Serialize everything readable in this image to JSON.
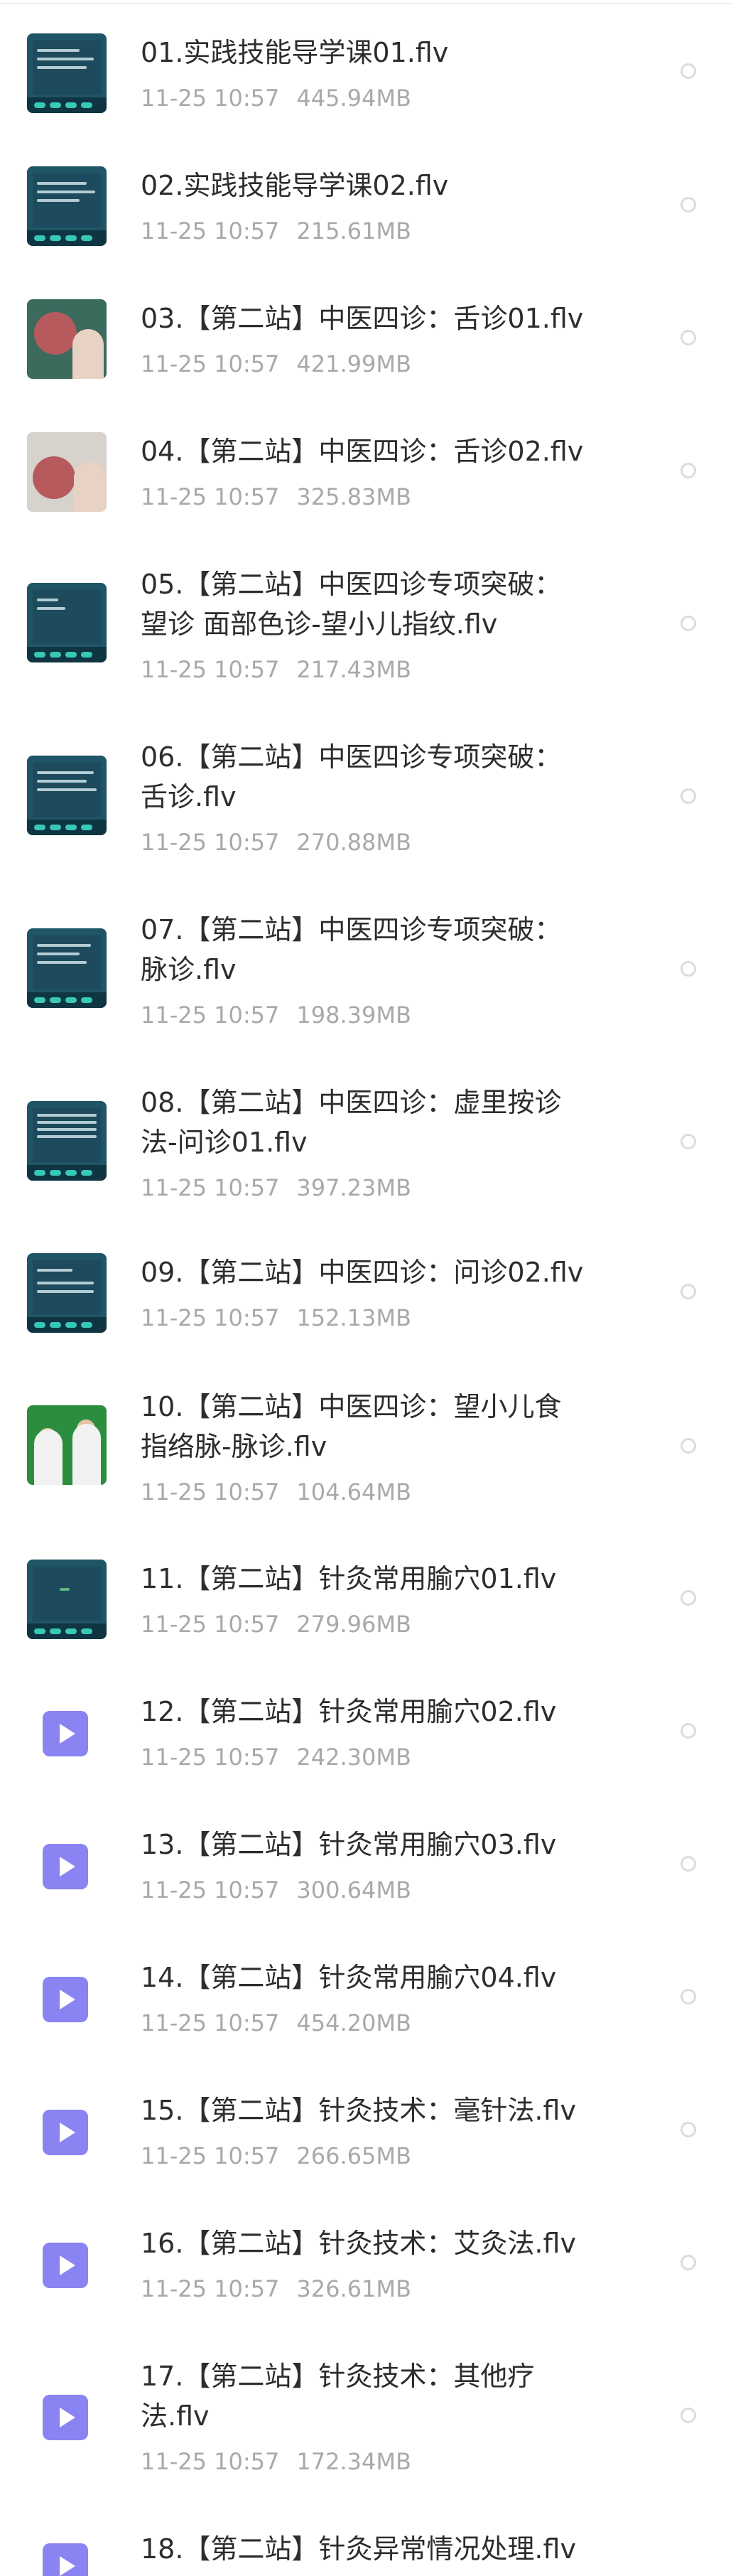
{
  "files": [
    {
      "name": "01.实践技能导学课01.flv",
      "time": "11-25  10:57",
      "size": "445.94MB",
      "icon": "video-thumbnail-slide"
    },
    {
      "name": "02.实践技能导学课02.flv",
      "time": "11-25  10:57",
      "size": "215.61MB",
      "icon": "video-thumbnail-slide"
    },
    {
      "name": "03.【第二站】中医四诊：舌诊01.flv",
      "time": "11-25  10:57",
      "size": "421.99MB",
      "icon": "video-thumbnail-tongue"
    },
    {
      "name": "04.【第二站】中医四诊：舌诊02.flv",
      "time": "11-25  10:57",
      "size": "325.83MB",
      "icon": "video-thumbnail-tongue"
    },
    {
      "name": "05.【第二站】中医四诊专项突破：\n望诊 面部色诊-望小儿指纹.flv",
      "time": "11-25  10:57",
      "size": "217.43MB",
      "icon": "video-thumbnail-slide"
    },
    {
      "name": "06.【第二站】中医四诊专项突破：\n舌诊.flv",
      "time": "11-25  10:57",
      "size": "270.88MB",
      "icon": "video-thumbnail-slide"
    },
    {
      "name": "07.【第二站】中医四诊专项突破：\n脉诊.flv",
      "time": "11-25  10:57",
      "size": "198.39MB",
      "icon": "video-thumbnail-slide"
    },
    {
      "name": "08.【第二站】中医四诊：虚里按诊\n法-问诊01.flv",
      "time": "11-25  10:57",
      "size": "397.23MB",
      "icon": "video-thumbnail-slide"
    },
    {
      "name": "09.【第二站】中医四诊：问诊02.flv",
      "time": "11-25  10:57",
      "size": "152.13MB",
      "icon": "video-thumbnail-slide"
    },
    {
      "name": "10.【第二站】中医四诊：望小儿食\n指络脉-脉诊.flv",
      "time": "11-25  10:57",
      "size": "104.64MB",
      "icon": "video-thumbnail-greenscreen"
    },
    {
      "name": "11.【第二站】针灸常用腧穴01.flv",
      "time": "11-25  10:57",
      "size": "279.96MB",
      "icon": "video-thumbnail-slide"
    },
    {
      "name": "12.【第二站】针灸常用腧穴02.flv",
      "time": "11-25  10:57",
      "size": "242.30MB",
      "icon": "play-icon"
    },
    {
      "name": "13.【第二站】针灸常用腧穴03.flv",
      "time": "11-25  10:57",
      "size": "300.64MB",
      "icon": "play-icon"
    },
    {
      "name": "14.【第二站】针灸常用腧穴04.flv",
      "time": "11-25  10:57",
      "size": "454.20MB",
      "icon": "play-icon"
    },
    {
      "name": "15.【第二站】针灸技术：毫针法.flv",
      "time": "11-25  10:57",
      "size": "266.65MB",
      "icon": "play-icon"
    },
    {
      "name": "16.【第二站】针灸技术：艾灸法.flv",
      "time": "11-25  10:57",
      "size": "326.61MB",
      "icon": "play-icon"
    },
    {
      "name": "17.【第二站】针灸技术：其他疗\n法.flv",
      "time": "11-25  10:57",
      "size": "172.34MB",
      "icon": "play-icon"
    },
    {
      "name": "18.【第二站】针灸异常情况处理.flv",
      "time": "",
      "size": "",
      "icon": "play-icon"
    }
  ],
  "colors": {
    "title_text": "#2d2d2d",
    "meta_text": "#a9a9a9",
    "play_icon": "#8a83f2",
    "radio_border": "#dcdcdc"
  }
}
